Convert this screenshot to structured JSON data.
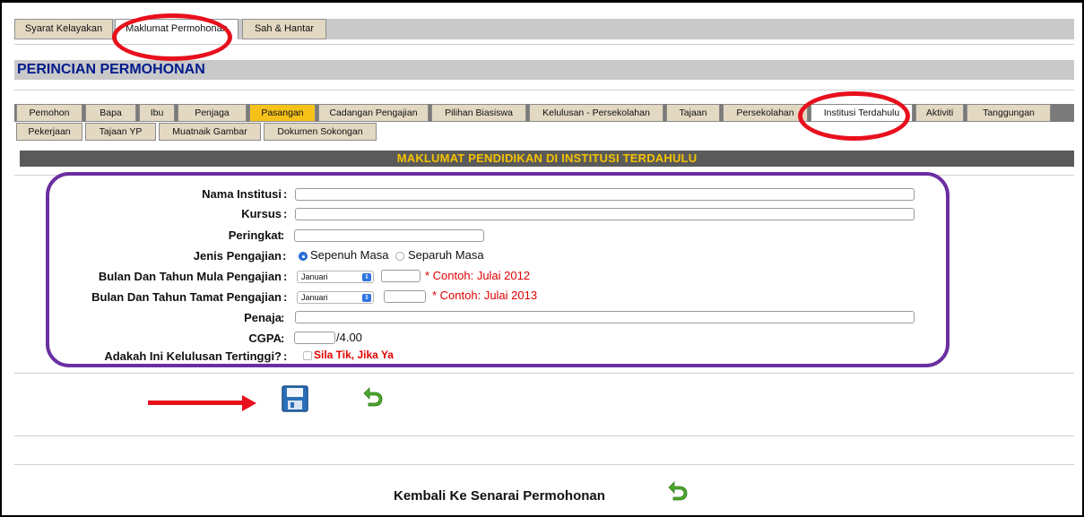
{
  "top_tabs": [
    {
      "label": "Syarat Kelayakan",
      "active": false
    },
    {
      "label": "Maklumat Permohonan",
      "active": true
    },
    {
      "label": "Sah & Hantar",
      "active": false
    }
  ],
  "section_title": "PERINCIAN PERMOHONAN",
  "sub_tabs_row1": [
    {
      "label": "Pemohon",
      "state": "normal"
    },
    {
      "label": "Bapa",
      "state": "normal"
    },
    {
      "label": "Ibu",
      "state": "normal"
    },
    {
      "label": "Penjaga",
      "state": "normal"
    },
    {
      "label": "Pasangan",
      "state": "highlight"
    },
    {
      "label": "Cadangan Pengajian",
      "state": "normal"
    },
    {
      "label": "Pilihan Biasiswa",
      "state": "normal"
    },
    {
      "label": "Kelulusan - Persekolahan",
      "state": "normal"
    },
    {
      "label": "Tajaan",
      "state": "normal"
    },
    {
      "label": "Persekolahan",
      "state": "normal"
    },
    {
      "label": "Institusi Terdahulu",
      "state": "active"
    },
    {
      "label": "Aktiviti",
      "state": "normal"
    },
    {
      "label": "Tanggungan",
      "state": "normal"
    }
  ],
  "sub_tabs_row2": [
    {
      "label": "Pekerjaan",
      "state": "normal"
    },
    {
      "label": "Tajaan YP",
      "state": "normal"
    },
    {
      "label": "Muatnaik Gambar",
      "state": "normal"
    },
    {
      "label": "Dokumen Sokongan",
      "state": "normal"
    }
  ],
  "form_heading": "MAKLUMAT PENDIDIKAN DI INSTITUSI TERDAHULU",
  "form": {
    "colon": ":",
    "nama_institusi": {
      "label": "Nama Institusi",
      "value": ""
    },
    "kursus": {
      "label": "Kursus",
      "value": ""
    },
    "peringkat": {
      "label": "Peringkat",
      "value": ""
    },
    "jenis_pengajian": {
      "label": "Jenis Pengajian",
      "options": [
        "Sepenuh Masa",
        "Separuh Masa"
      ],
      "selected": "Sepenuh Masa"
    },
    "mula": {
      "label": "Bulan Dan Tahun Mula Pengajian",
      "month": "Januari",
      "year": "",
      "note": "* Contoh: Julai 2012"
    },
    "tamat": {
      "label": "Bulan Dan Tahun Tamat Pengajian",
      "month": "Januari",
      "year": "",
      "note": "* Contoh: Julai 2013"
    },
    "penaja": {
      "label": "Penaja",
      "value": ""
    },
    "cgpa": {
      "label": "CGPA",
      "value": "",
      "suffix": "/4.00"
    },
    "kelulusan": {
      "label": "Adakah Ini Kelulusan Tertinggi?",
      "check_label": "Sila Tik, Jika Ya",
      "checked": false
    }
  },
  "actions": {
    "save_icon": "floppy-disk-icon",
    "back_icon": "return-arrow-icon"
  },
  "footer": {
    "link_label": "Kembali Ke Senarai Permohonan",
    "icon": "return-arrow-icon"
  },
  "colors": {
    "annotation_red": "#e8101c",
    "annotation_purple": "#6a2fa0",
    "heading_yellow": "#f4c200",
    "title_blue": "#001a8c",
    "tab_highlight": "#f6c21a"
  }
}
